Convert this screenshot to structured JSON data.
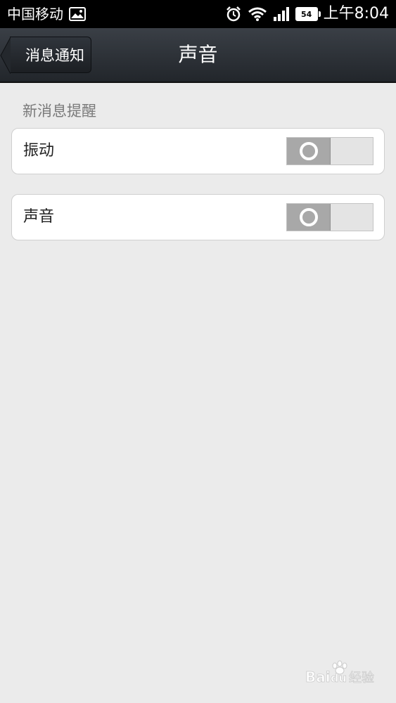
{
  "status_bar": {
    "carrier": "中国移动",
    "battery_level": "54",
    "time": "上午8:04",
    "icons": [
      "image-icon",
      "alarm-icon",
      "wifi-icon",
      "signal-icon",
      "battery-icon"
    ]
  },
  "header": {
    "back_label": "消息通知",
    "title": "声音"
  },
  "section": {
    "title": "新消息提醒",
    "items": [
      {
        "label": "振动",
        "enabled": false
      },
      {
        "label": "声音",
        "enabled": false
      }
    ]
  },
  "watermark": {
    "text": "Baidu经验"
  },
  "colors": {
    "background": "#ebebeb",
    "header_bg": "#2c3036",
    "toggle_thumb": "#a8a8a8"
  }
}
